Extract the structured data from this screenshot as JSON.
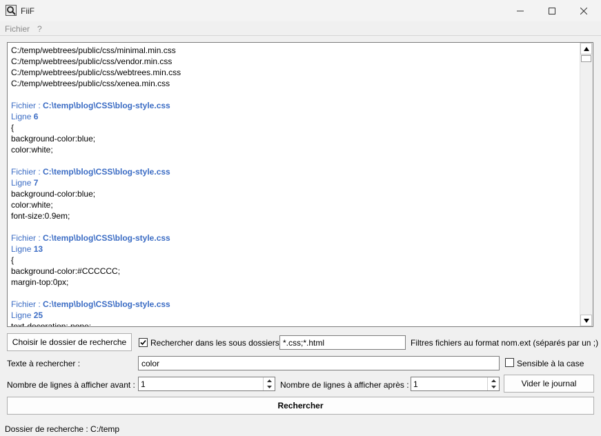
{
  "window": {
    "title": "FiiF",
    "app_icon": "magnifier-icon",
    "controls": [
      "minimize-icon",
      "maximize-icon",
      "close-icon"
    ]
  },
  "menu": [
    {
      "label": "Fichier"
    },
    {
      "label": "?"
    }
  ],
  "log": {
    "lines": [
      {
        "type": "plain",
        "text": "C:/temp/webtrees/public/css/minimal.min.css"
      },
      {
        "type": "plain",
        "text": "C:/temp/webtrees/public/css/vendor.min.css"
      },
      {
        "type": "plain",
        "text": "C:/temp/webtrees/public/css/webtrees.min.css"
      },
      {
        "type": "plain",
        "text": "C:/temp/webtrees/public/css/xenea.min.css"
      },
      {
        "type": "blank",
        "text": ""
      },
      {
        "type": "file",
        "prefix": "Fichier : ",
        "value": "C:\\temp\\blog\\CSS\\blog-style.css"
      },
      {
        "type": "line",
        "prefix": "Ligne ",
        "value": "6"
      },
      {
        "type": "plain",
        "text": "{"
      },
      {
        "type": "plain",
        "text": "background-color:blue;"
      },
      {
        "type": "plain",
        "text": "color:white;"
      },
      {
        "type": "blank",
        "text": ""
      },
      {
        "type": "file",
        "prefix": "Fichier : ",
        "value": "C:\\temp\\blog\\CSS\\blog-style.css"
      },
      {
        "type": "line",
        "prefix": "Ligne ",
        "value": "7"
      },
      {
        "type": "plain",
        "text": "background-color:blue;"
      },
      {
        "type": "plain",
        "text": "color:white;"
      },
      {
        "type": "plain",
        "text": "font-size:0.9em;"
      },
      {
        "type": "blank",
        "text": ""
      },
      {
        "type": "file",
        "prefix": "Fichier : ",
        "value": "C:\\temp\\blog\\CSS\\blog-style.css"
      },
      {
        "type": "line",
        "prefix": "Ligne ",
        "value": "13"
      },
      {
        "type": "plain",
        "text": "{"
      },
      {
        "type": "plain",
        "text": "background-color:#CCCCCC;"
      },
      {
        "type": "plain",
        "text": "margin-top:0px;"
      },
      {
        "type": "blank",
        "text": ""
      },
      {
        "type": "file",
        "prefix": "Fichier : ",
        "value": "C:\\temp\\blog\\CSS\\blog-style.css"
      },
      {
        "type": "line",
        "prefix": "Ligne ",
        "value": "25"
      },
      {
        "type": "plain",
        "text": "text-decoration: none;"
      }
    ],
    "link_color": "#3b6cc4"
  },
  "controls": {
    "choose_folder_button": "Choisir le dossier de recherche",
    "subfolders_checkbox": {
      "label": "Rechercher dans les sous dossiers",
      "checked": true
    },
    "filter_value": "*.css;*.html",
    "filter_hint": "Filtres fichiers au format nom.ext (séparés par un ;)",
    "search_text_label": "Texte à rechercher :",
    "search_text_value": "color",
    "case_checkbox": {
      "label": "Sensible à la case",
      "checked": false
    },
    "lines_before_label": "Nombre de lignes à afficher avant :",
    "lines_before_value": "1",
    "lines_after_label": "Nombre de lignes à afficher après :",
    "lines_after_value": "1",
    "clear_log_button": "Vider le journal",
    "search_button": "Rechercher"
  },
  "status": {
    "text": "Dossier de recherche : C:/temp"
  }
}
